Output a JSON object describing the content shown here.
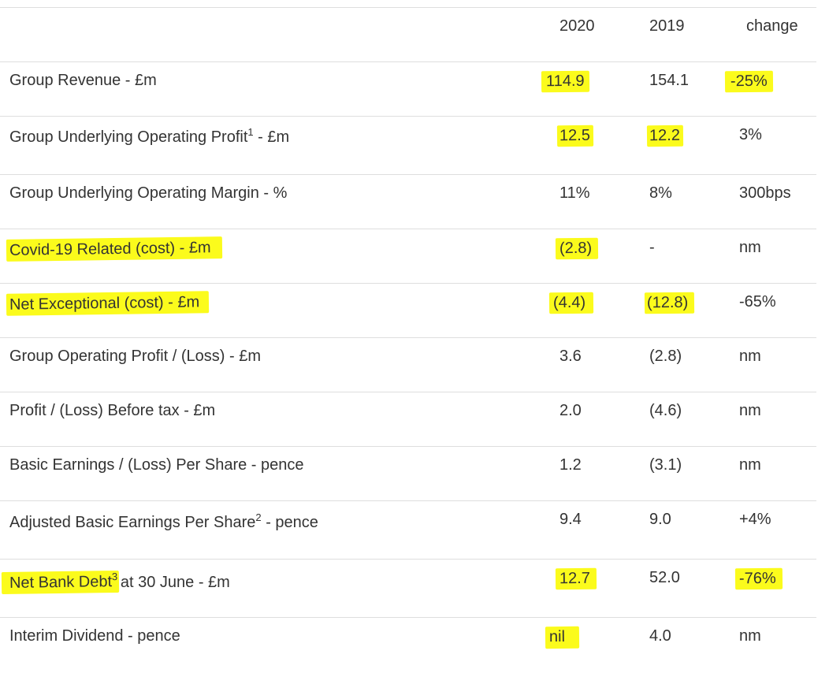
{
  "header": {
    "col_2020": "2020",
    "col_2019": "2019",
    "col_change": "change"
  },
  "rows": [
    {
      "label": "Group Revenue - £m",
      "sup": "",
      "label_after": "",
      "v2020": "114.9",
      "v2019": "154.1",
      "change": "-25%"
    },
    {
      "label": "Group Underlying Operating Profit",
      "sup": "1",
      "label_after": " - £m",
      "v2020": "12.5",
      "v2019": "12.2",
      "change": "3%"
    },
    {
      "label": "Group Underlying Operating Margin - %",
      "sup": "",
      "label_after": "",
      "v2020": "11%",
      "v2019": "8%",
      "change": "300bps"
    },
    {
      "label": "Covid-19 Related (cost) - £m",
      "sup": "",
      "label_after": "",
      "v2020": "(2.8)",
      "v2019": "-",
      "change": "nm"
    },
    {
      "label": "Net Exceptional (cost) - £m",
      "sup": "",
      "label_after": "",
      "v2020": "(4.4)",
      "v2019": "(12.8)",
      "change": "-65%"
    },
    {
      "label": "Group Operating Profit / (Loss) - £m",
      "sup": "",
      "label_after": "",
      "v2020": "3.6",
      "v2019": "(2.8)",
      "change": "nm"
    },
    {
      "label": "Profit / (Loss) Before tax - £m",
      "sup": "",
      "label_after": "",
      "v2020": "2.0",
      "v2019": "(4.6)",
      "change": "nm"
    },
    {
      "label": "Basic Earnings / (Loss) Per Share - pence",
      "sup": "",
      "label_after": "",
      "v2020": "1.2",
      "v2019": "(3.1)",
      "change": "nm"
    },
    {
      "label": "Adjusted Basic Earnings Per Share",
      "sup": "2",
      "label_after": " - pence",
      "v2020": "9.4",
      "v2019": "9.0",
      "change": "+4%"
    },
    {
      "label": "Net Bank Debt",
      "sup": "3",
      "label_after": " at 30 June - £m",
      "v2020": "12.7",
      "v2019": "52.0",
      "change": "-76%"
    },
    {
      "label": "Interim Dividend - pence",
      "sup": "",
      "label_after": "",
      "v2020": "nil",
      "v2019": "4.0",
      "change": "nm"
    }
  ],
  "highlight_color": "#fbfb1c",
  "border_color": "#dedede",
  "text_color": "#333333"
}
